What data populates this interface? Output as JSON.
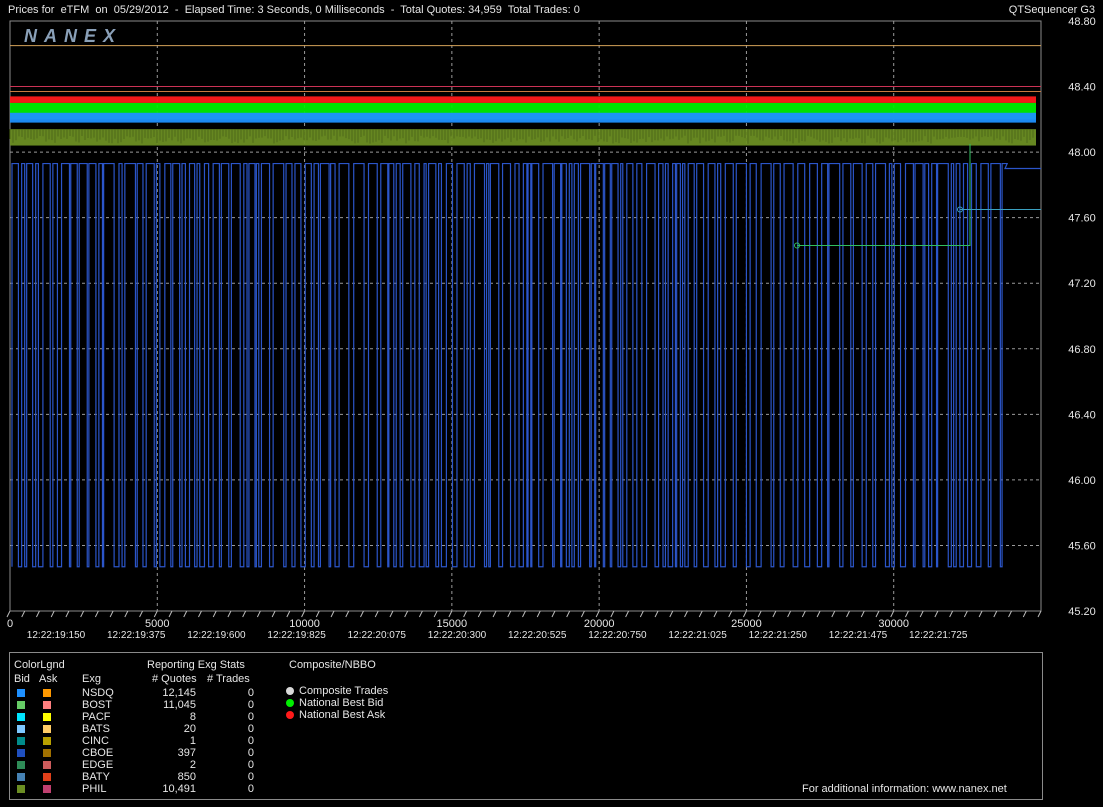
{
  "header": {
    "title": "Prices for  eTFM  on  05/29/2012  -  Elapsed Time: 3 Seconds, 0 Milliseconds  -  Total Quotes: 34,959  Total Trades: 0",
    "app": "QTSequencer G3"
  },
  "logo": {
    "text": "NANEX"
  },
  "chart_data": {
    "type": "line",
    "title": "",
    "xlabel": "",
    "ylabel": "",
    "xlim": [
      0,
      35000
    ],
    "ylim": [
      45.2,
      48.8
    ],
    "x_ticks": [
      0,
      5000,
      10000,
      15000,
      20000,
      25000,
      30000
    ],
    "y_ticks": [
      "45.20",
      "45.60",
      "46.00",
      "46.40",
      "46.80",
      "47.20",
      "47.60",
      "48.00",
      "48.40",
      "48.80"
    ],
    "time_labels": [
      "12:22:19:150",
      "12:22:19:375",
      "12:22:19:600",
      "12:22:19:825",
      "12:22:20:075",
      "12:22:20:300",
      "12:22:20:525",
      "12:22:20:750",
      "12:22:21:025",
      "12:22:21:250",
      "12:22:21:475",
      "12:22:21:725"
    ],
    "grid": true,
    "series": [
      {
        "name": "National Best Ask",
        "color": "#ff1a1a",
        "y_band": [
          48.3,
          48.34
        ]
      },
      {
        "name": "National Best Bid",
        "color": "#00ee00",
        "y_band": [
          48.2,
          48.3
        ]
      },
      {
        "name": "PHIL",
        "color": "#6b8e23",
        "y_band": [
          48.04,
          48.14
        ]
      },
      {
        "name": "NSDQ",
        "color": "#1e90ff",
        "y_band": [
          48.18,
          48.24
        ]
      },
      {
        "name": "CBOE",
        "color": "#2b55c9",
        "pattern": "flicker",
        "y_high": 47.93,
        "y_low": 45.47
      }
    ],
    "lines": [
      {
        "name": "BATS ask",
        "color": "#d4a25a",
        "y": 48.65
      },
      {
        "name": "PHIL ask",
        "color": "#cc3355",
        "y": 48.4
      },
      {
        "name": "EDGE ask",
        "color": "#c87a40",
        "y": 48.37
      }
    ]
  },
  "legend": {
    "colorlgnd": "ColorLgnd",
    "bid": "Bid",
    "ask": "Ask",
    "exg": "Exg",
    "stats_title": "Reporting Exg Stats",
    "quotes_header": "# Quotes",
    "trades_header": "# Trades",
    "composite_title": "Composite/NBBO",
    "composite_items": [
      {
        "label": "Composite Trades",
        "color": "#d9d9d9"
      },
      {
        "label": "National Best Bid",
        "color": "#00ee00"
      },
      {
        "label": "National Best Ask",
        "color": "#ff1a1a"
      }
    ],
    "rows": [
      {
        "exg": "NSDQ",
        "bid_color": "#1e90ff",
        "ask_color": "#ff9900",
        "quotes": "12,145",
        "trades": "0"
      },
      {
        "exg": "BOST",
        "bid_color": "#66cc66",
        "ask_color": "#ff8080",
        "quotes": "11,045",
        "trades": "0"
      },
      {
        "exg": "PACF",
        "bid_color": "#00e5ff",
        "ask_color": "#ffff00",
        "quotes": "8",
        "trades": "0"
      },
      {
        "exg": "BATS",
        "bid_color": "#7ec8ff",
        "ask_color": "#ffcc66",
        "quotes": "20",
        "trades": "0"
      },
      {
        "exg": "CINC",
        "bid_color": "#008b8b",
        "ask_color": "#b8a000",
        "quotes": "1",
        "trades": "0"
      },
      {
        "exg": "CBOE",
        "bid_color": "#1f4fbf",
        "ask_color": "#a07000",
        "quotes": "397",
        "trades": "0"
      },
      {
        "exg": "EDGE",
        "bid_color": "#2e8b57",
        "ask_color": "#cd5c5c",
        "quotes": "2",
        "trades": "0"
      },
      {
        "exg": "BATY",
        "bid_color": "#4682b4",
        "ask_color": "#e0401a",
        "quotes": "850",
        "trades": "0"
      },
      {
        "exg": "PHIL",
        "bid_color": "#6b8e23",
        "ask_color": "#c04070",
        "quotes": "10,491",
        "trades": "0"
      }
    ],
    "footer": "For additional information: www.nanex.net"
  }
}
